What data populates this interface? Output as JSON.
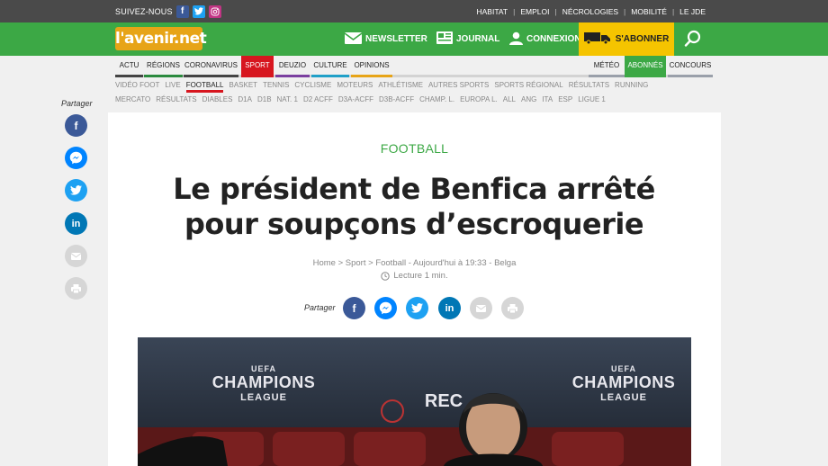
{
  "topbar": {
    "follow_label": "SUIVEZ-NOUS",
    "links": [
      "HABITAT",
      "EMPLOI",
      "NÉCROLOGIES",
      "MOBILITÉ",
      "LE JDE"
    ]
  },
  "header": {
    "logo_text": "l'avenir.net",
    "newsletter": "NEWSLETTER",
    "journal": "JOURNAL",
    "connexion": "CONNEXION",
    "subscribe": "S'ABONNER"
  },
  "section_nav": {
    "items": [
      "ACTU",
      "RÉGIONS",
      "CORONAVIRUS",
      "SPORT",
      "DEUZIO",
      "CULTURE",
      "OPINIONS",
      "MÉTÉO",
      "ABONNÉS",
      "CONCOURS"
    ],
    "active": "SPORT"
  },
  "subnav1": [
    "VIDÉO FOOT",
    "LIVE",
    "FOOTBALL",
    "BASKET",
    "TENNIS",
    "CYCLISME",
    "MOTEURS",
    "ATHLÉTISME",
    "AUTRES SPORTS",
    "SPORTS RÉGIONAL",
    "RÉSULTATS",
    "RUNNING"
  ],
  "subnav2": [
    "MERCATO",
    "RÉSULTATS",
    "DIABLES",
    "D1A",
    "D1B",
    "NAT. 1",
    "D2 ACFF",
    "D3A-ACFF",
    "D3B-ACFF",
    "CHAMP. L.",
    "EUROPA L.",
    "ALL",
    "ANG",
    "ITA",
    "ESP",
    "LIGUE 1"
  ],
  "share": {
    "label": "Partager"
  },
  "article": {
    "kicker": "FOOTBALL",
    "title": "Le président de Benfica arrêté pour soupçons d’escroquerie",
    "breadcrumb_home": "Home",
    "breadcrumb_sport": "Sport",
    "breadcrumb_section": "Football",
    "published": "Aujourd'hui à 19:33",
    "source": "Belga",
    "reading_time": "Lecture 1 min."
  },
  "photo": {
    "banner_uefa": "UEFA",
    "banner_line1": "CHAMPIONS",
    "banner_line2": "LEAGUE",
    "sponsor": "REC"
  },
  "colors": {
    "green": "#3ca845",
    "red": "#d7161f",
    "yellow": "#f5c400",
    "facebook": "#3b5998",
    "messenger": "#0084ff",
    "twitter": "#1da1f2",
    "linkedin": "#0077b5"
  }
}
